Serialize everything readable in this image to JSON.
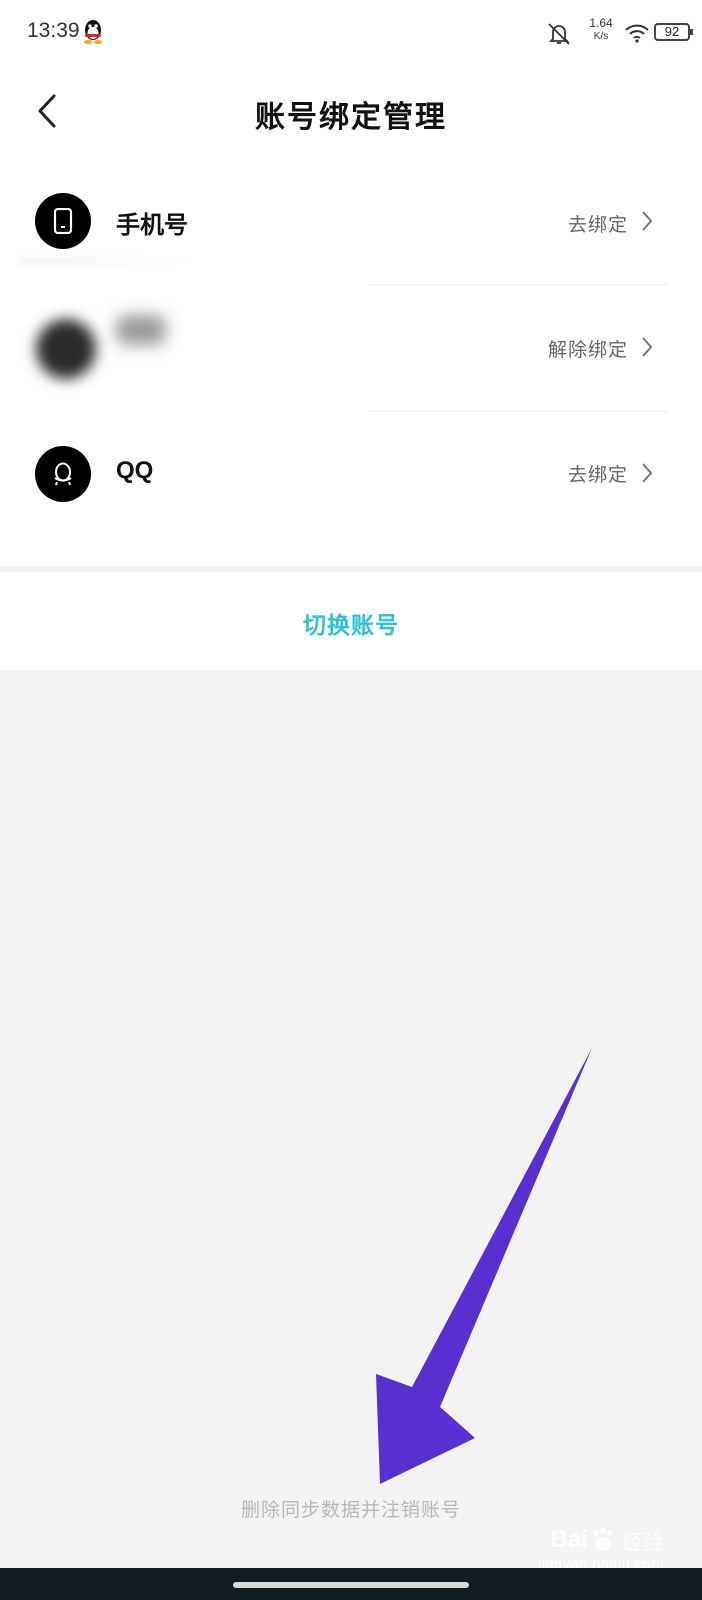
{
  "status_bar": {
    "time": "13:39",
    "net_speed_value": "1.64",
    "net_speed_unit": "K/s",
    "battery": "92",
    "icons": [
      "qq-icon",
      "mute-bell-icon",
      "wifi-icon",
      "battery-icon"
    ]
  },
  "header": {
    "title": "账号绑定管理",
    "back_icon": "chevron-left-icon"
  },
  "bind_list": [
    {
      "name": "phone",
      "label": "手机号",
      "action": "去绑定",
      "icon": "phone-icon"
    },
    {
      "name": "redacted-account",
      "label": "",
      "action": "解除绑定",
      "icon": "blurred-avatar"
    },
    {
      "name": "qq",
      "label": "QQ",
      "action": "去绑定",
      "icon": "qq-icon"
    }
  ],
  "switch_account": {
    "label": "切换账号",
    "color": "#2ec1d6"
  },
  "delete_account": {
    "label": "删除同步数据并注销账号"
  },
  "annotation": {
    "arrow_color": "#5a2fd0"
  },
  "watermark": {
    "brand": "Bai",
    "brand_cn": "经验",
    "url": "jingyan.baidu.com"
  }
}
